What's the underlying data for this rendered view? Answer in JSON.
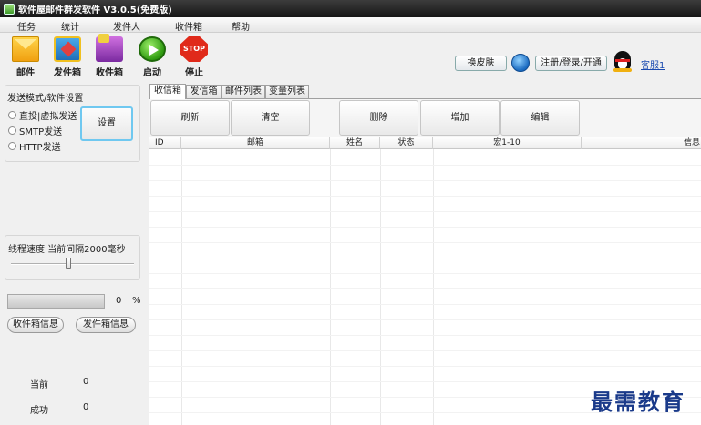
{
  "window": {
    "title": "软件屋邮件群发软件 V3.0.5(免费版)"
  },
  "menu": [
    "任务",
    "统计",
    "发件人",
    "收件箱",
    "帮助"
  ],
  "toolbar": {
    "mail": "邮件",
    "outbox": "发件箱",
    "inbox": "收件箱",
    "start": "启动",
    "stop": "停止",
    "stop_sign": "STOP",
    "skin": "换皮肤",
    "register": "注册/登录/开通",
    "service": "客服1"
  },
  "left": {
    "send_mode_title": "发送模式/软件设置",
    "modes": [
      "直投|虚拟发送",
      "SMTP发送",
      "HTTP发送"
    ],
    "settings_button": "设置",
    "thread_speed": "线程速度  当前间隔2000毫秒",
    "progress_value": "0",
    "progress_unit": "%",
    "progress_percent": 0,
    "inbox_info": "收件箱信息",
    "outbox_info": "发件箱信息",
    "current_label": "当前",
    "current_value": "0",
    "success_label": "成功",
    "success_value": "0"
  },
  "tabs": [
    "收信箱",
    "发信箱",
    "邮件列表",
    "变量列表"
  ],
  "actions": {
    "refresh": "刷新",
    "clear": "清空",
    "delete": "删除",
    "add": "增加",
    "edit": "编辑"
  },
  "table": {
    "columns": [
      "ID",
      "邮箱",
      "姓名",
      "状态",
      "宏1-10",
      "信息"
    ]
  },
  "watermark": "最需教育",
  "colors": {
    "titlebar": "#1e1e1e",
    "settings_border": "#6fc8f0",
    "watermark": "#1a3a8a"
  }
}
